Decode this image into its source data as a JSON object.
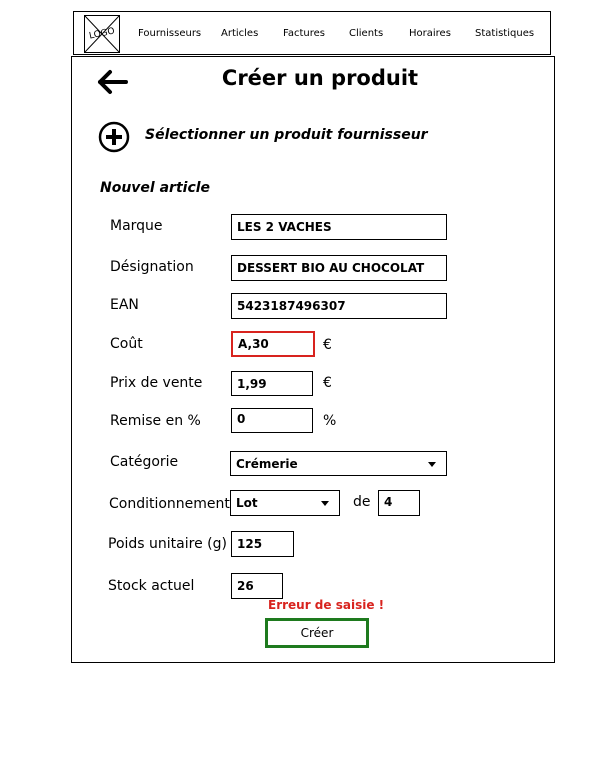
{
  "nav": {
    "logo_text": "LOGO",
    "items": [
      "Fournisseurs",
      "Articles",
      "Factures",
      "Clients",
      "Horaires",
      "Statistiques"
    ]
  },
  "page": {
    "title": "Créer un produit",
    "select_supplier_label": "Sélectionner un produit fournisseur",
    "section_title": "Nouvel article"
  },
  "form": {
    "marque": {
      "label": "Marque",
      "value": "LES 2 VACHES"
    },
    "designation": {
      "label": "Désignation",
      "value": "DESSERT BIO AU CHOCOLAT"
    },
    "ean": {
      "label": "EAN",
      "value": "5423187496307"
    },
    "cout": {
      "label": "Coût",
      "value": "A,30",
      "unit": "€",
      "error": true
    },
    "prix_vente": {
      "label": "Prix de vente",
      "value": "1,99",
      "unit": "€"
    },
    "remise": {
      "label": "Remise en %",
      "value": "0",
      "unit": "%"
    },
    "categorie": {
      "label": "Catégorie",
      "value": "Crémerie"
    },
    "conditionnement": {
      "label": "Conditionnement",
      "value": "Lot",
      "de_label": "de",
      "quantity": "4"
    },
    "poids": {
      "label": "Poids unitaire (g)",
      "value": "125"
    },
    "stock": {
      "label": "Stock actuel",
      "value": "26"
    }
  },
  "error_message": "Erreur de saisie !",
  "create_button": "Créer",
  "colors": {
    "error": "#d8231e",
    "create_border": "#1e7a1e"
  },
  "icons": {
    "back": "arrow-left-icon",
    "add": "plus-circle-icon",
    "dropdown": "chevron-down-icon"
  }
}
